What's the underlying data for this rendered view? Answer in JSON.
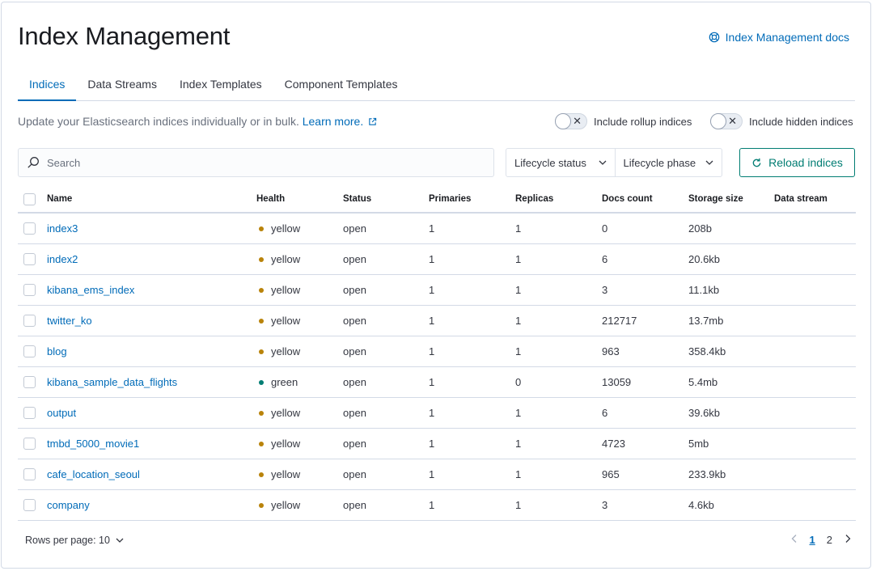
{
  "header": {
    "title": "Index Management",
    "docs_link": "Index Management docs"
  },
  "tabs": [
    {
      "label": "Indices",
      "selected": true
    },
    {
      "label": "Data Streams",
      "selected": false
    },
    {
      "label": "Index Templates",
      "selected": false
    },
    {
      "label": "Component Templates",
      "selected": false
    }
  ],
  "description": {
    "text": "Update your Elasticsearch indices individually or in bulk.",
    "learn_more": "Learn more."
  },
  "toggles": {
    "rollup_label": "Include rollup indices",
    "hidden_label": "Include hidden indices"
  },
  "search": {
    "placeholder": "Search"
  },
  "filters": {
    "lifecycle_status": "Lifecycle status",
    "lifecycle_phase": "Lifecycle phase"
  },
  "reload_label": "Reload indices",
  "columns": {
    "name": "Name",
    "health": "Health",
    "status": "Status",
    "primaries": "Primaries",
    "replicas": "Replicas",
    "docs_count": "Docs count",
    "storage_size": "Storage size",
    "data_stream": "Data stream"
  },
  "rows": [
    {
      "name": "index3",
      "health": "yellow",
      "status": "open",
      "primaries": "1",
      "replicas": "1",
      "docs_count": "0",
      "storage_size": "208b",
      "data_stream": ""
    },
    {
      "name": "index2",
      "health": "yellow",
      "status": "open",
      "primaries": "1",
      "replicas": "1",
      "docs_count": "6",
      "storage_size": "20.6kb",
      "data_stream": ""
    },
    {
      "name": "kibana_ems_index",
      "health": "yellow",
      "status": "open",
      "primaries": "1",
      "replicas": "1",
      "docs_count": "3",
      "storage_size": "11.1kb",
      "data_stream": ""
    },
    {
      "name": "twitter_ko",
      "health": "yellow",
      "status": "open",
      "primaries": "1",
      "replicas": "1",
      "docs_count": "212717",
      "storage_size": "13.7mb",
      "data_stream": ""
    },
    {
      "name": "blog",
      "health": "yellow",
      "status": "open",
      "primaries": "1",
      "replicas": "1",
      "docs_count": "963",
      "storage_size": "358.4kb",
      "data_stream": ""
    },
    {
      "name": "kibana_sample_data_flights",
      "health": "green",
      "status": "open",
      "primaries": "1",
      "replicas": "0",
      "docs_count": "13059",
      "storage_size": "5.4mb",
      "data_stream": ""
    },
    {
      "name": "output",
      "health": "yellow",
      "status": "open",
      "primaries": "1",
      "replicas": "1",
      "docs_count": "6",
      "storage_size": "39.6kb",
      "data_stream": ""
    },
    {
      "name": "tmbd_5000_movie1",
      "health": "yellow",
      "status": "open",
      "primaries": "1",
      "replicas": "1",
      "docs_count": "4723",
      "storage_size": "5mb",
      "data_stream": ""
    },
    {
      "name": "cafe_location_seoul",
      "health": "yellow",
      "status": "open",
      "primaries": "1",
      "replicas": "1",
      "docs_count": "965",
      "storage_size": "233.9kb",
      "data_stream": ""
    },
    {
      "name": "company",
      "health": "yellow",
      "status": "open",
      "primaries": "1",
      "replicas": "1",
      "docs_count": "3",
      "storage_size": "4.6kb",
      "data_stream": ""
    }
  ],
  "footer": {
    "rows_per_page": "Rows per page: 10",
    "pages": [
      "1",
      "2"
    ],
    "current_page": "1"
  },
  "colors": {
    "link": "#006bb8",
    "accent_green": "#017d73",
    "health_yellow": "#b9830a",
    "health_green": "#017d73"
  }
}
